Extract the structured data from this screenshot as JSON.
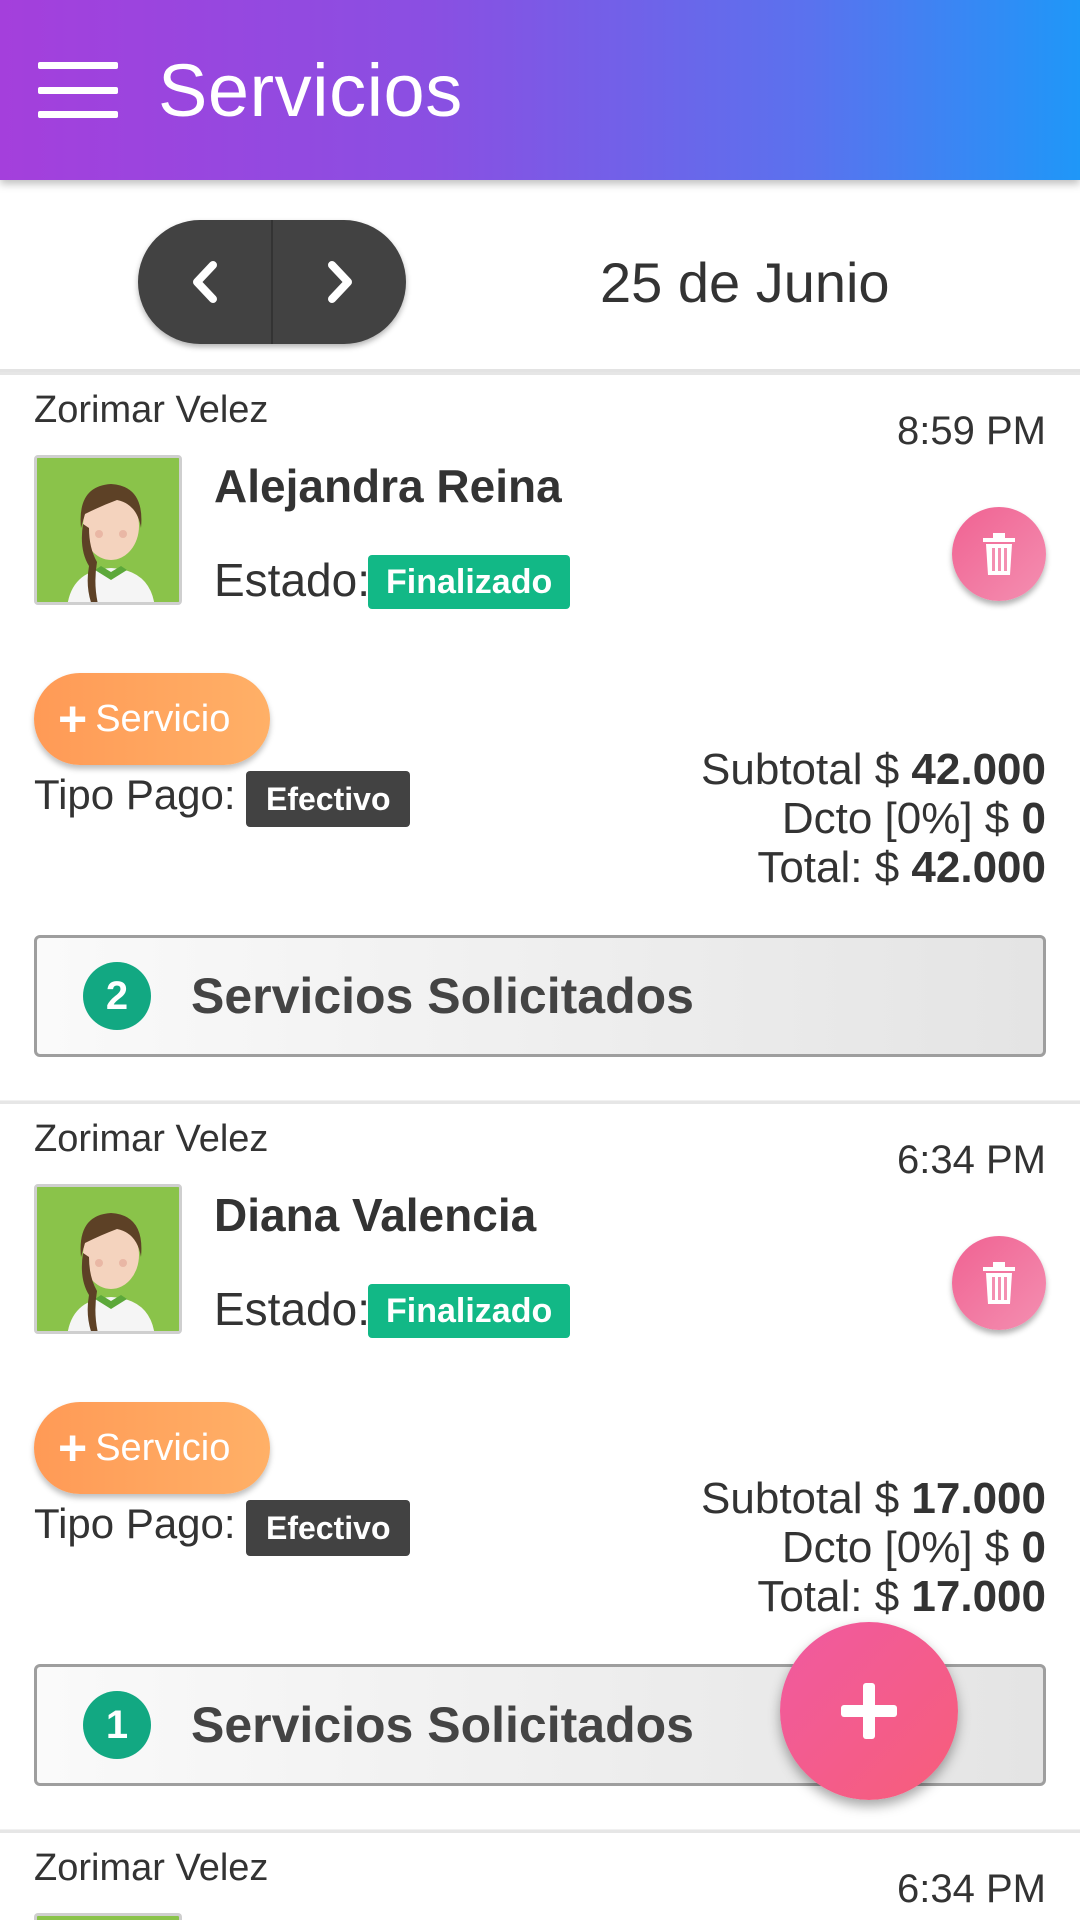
{
  "appbar": {
    "title": "Servicios",
    "menu_icon": "hamburger-icon"
  },
  "datebar": {
    "prev_icon": "chevron-left-icon",
    "next_icon": "chevron-right-icon",
    "date": "25 de Junio"
  },
  "cards": [
    {
      "worker": "Zorimar Velez",
      "time": "8:59 PM",
      "client": "Alejandra Reina",
      "estado_label": "Estado:",
      "estado": "Finalizado",
      "service_button": "Servicio",
      "tipo_pago_label": "Tipo Pago:",
      "tipo_pago": "Efectivo",
      "subtotal_label": "Subtotal $",
      "subtotal": "42.000",
      "dcto_label": "Dcto [0%] $",
      "dcto": "0",
      "total_label": "Total: $",
      "total": "42.000",
      "solicitados_count": "2",
      "solicitados_label": "Servicios Solicitados"
    },
    {
      "worker": "Zorimar Velez",
      "time": "6:34 PM",
      "client": "Diana Valencia",
      "estado_label": "Estado:",
      "estado": "Finalizado",
      "service_button": "Servicio",
      "tipo_pago_label": "Tipo Pago:",
      "tipo_pago": "Efectivo",
      "subtotal_label": "Subtotal $",
      "subtotal": "17.000",
      "dcto_label": "Dcto [0%] $",
      "dcto": "0",
      "total_label": "Total: $",
      "total": "17.000",
      "solicitados_count": "1",
      "solicitados_label": "Servicios Solicitados"
    },
    {
      "worker": "Zorimar Velez",
      "time": "6:34 PM"
    }
  ],
  "fab": {
    "icon": "plus-icon"
  },
  "colors": {
    "appbar_start": "#a43fdc",
    "appbar_end": "#1f97f8",
    "status_green": "#12b886",
    "service_orange": "#ff9a56",
    "trash_pink": "#f06292",
    "fab_pink": "#f05aa0",
    "dark_badge": "#424242"
  }
}
